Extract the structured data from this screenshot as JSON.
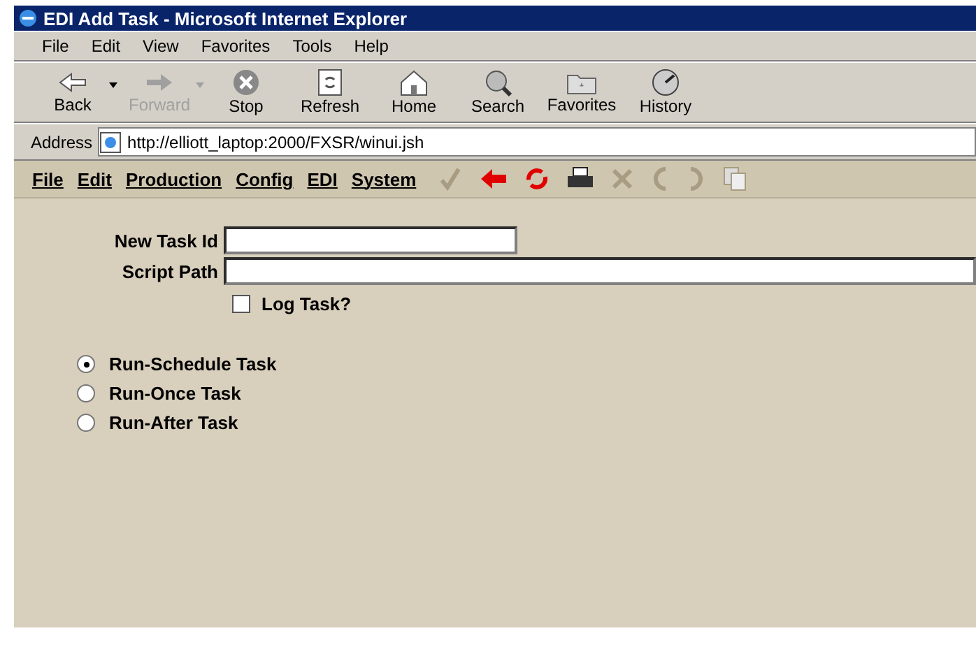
{
  "window": {
    "title": "EDI Add Task - Microsoft Internet Explorer"
  },
  "menu": [
    "File",
    "Edit",
    "View",
    "Favorites",
    "Tools",
    "Help"
  ],
  "toolbar": [
    {
      "kind": "back",
      "label": "Back",
      "disabled": false,
      "dropdown": true
    },
    {
      "kind": "forward",
      "label": "Forward",
      "disabled": true,
      "dropdown": true
    },
    {
      "kind": "stop",
      "label": "Stop",
      "disabled": false,
      "dropdown": false
    },
    {
      "kind": "refresh",
      "label": "Refresh",
      "disabled": false,
      "dropdown": false
    },
    {
      "kind": "home",
      "label": "Home",
      "disabled": false,
      "dropdown": false
    },
    {
      "kind": "search",
      "label": "Search",
      "disabled": false,
      "dropdown": false
    },
    {
      "kind": "favorites",
      "label": "Favorites",
      "disabled": false,
      "dropdown": false
    },
    {
      "kind": "history",
      "label": "History",
      "disabled": false,
      "dropdown": false
    }
  ],
  "address": {
    "label": "Address",
    "url": "http://elliott_laptop:2000/FXSR/winui.jsh"
  },
  "app_menu": [
    "File",
    "Edit",
    "Production",
    "Config",
    "EDI",
    "System"
  ],
  "app_tools": [
    {
      "kind": "check",
      "disabled": true
    },
    {
      "kind": "back",
      "disabled": false
    },
    {
      "kind": "refresh",
      "disabled": false
    },
    {
      "kind": "print",
      "disabled": false
    },
    {
      "kind": "delete",
      "disabled": true
    },
    {
      "kind": "undo",
      "disabled": true
    },
    {
      "kind": "redo",
      "disabled": true
    },
    {
      "kind": "copy",
      "disabled": true
    }
  ],
  "form": {
    "fields": [
      {
        "label": "New Task Id",
        "wide": false
      },
      {
        "label": "Script Path",
        "wide": true
      }
    ],
    "log_task": {
      "label": "Log Task?",
      "checked": false
    },
    "run_modes": [
      {
        "label": "Run-Schedule Task",
        "selected": true
      },
      {
        "label": "Run-Once Task",
        "selected": false
      },
      {
        "label": "Run-After Task",
        "selected": false
      }
    ]
  }
}
